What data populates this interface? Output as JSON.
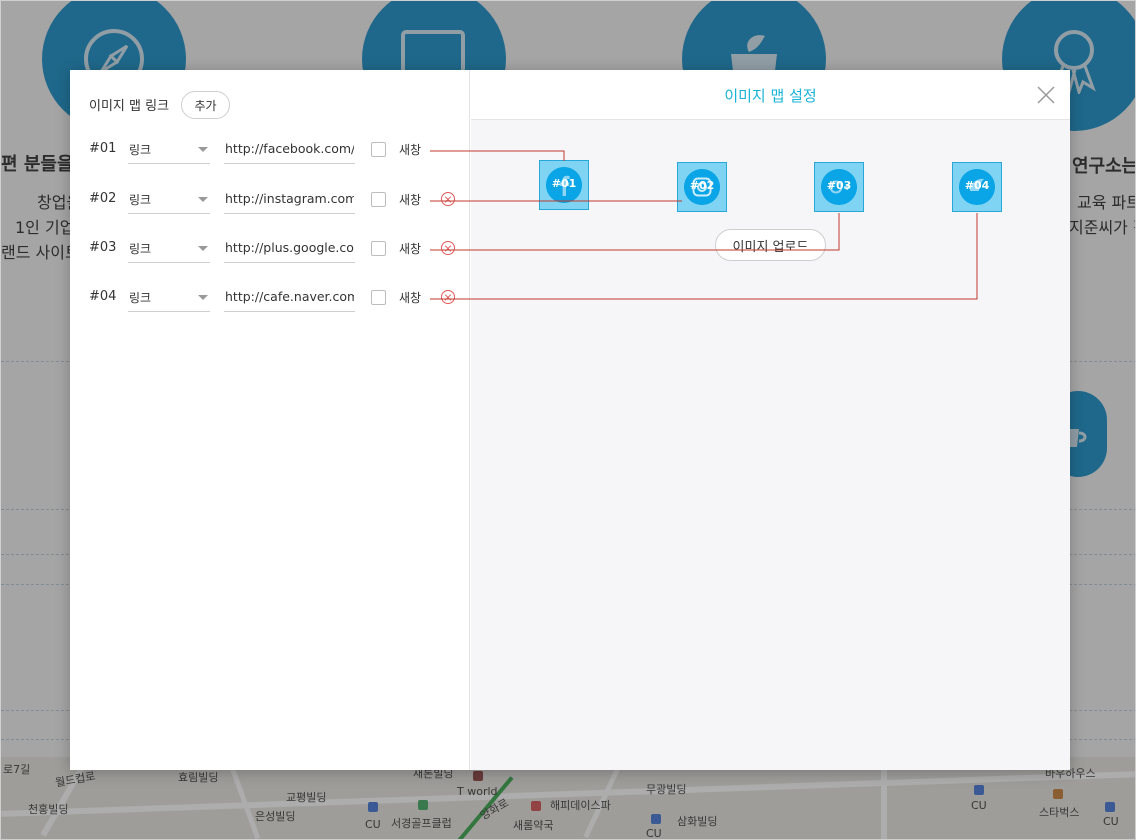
{
  "background": {
    "headings": [
      "편 분들을",
      "연구소는"
    ],
    "texts": [
      "창업을",
      "1인 기업",
      "랜드 사이트",
      "교육 파트",
      "지준씨가 직"
    ],
    "map_labels": [
      "로7길",
      "월드컵로",
      "천홍빌딩",
      "효림빌딩",
      "교평빌딩",
      "은성빌딩",
      "CU",
      "서경골프클럽",
      "새론빌딩",
      "T world",
      "양화로",
      "해피데이스파",
      "새롬약국",
      "무광빌딩",
      "삼화빌딩",
      "CU",
      "CU",
      "스타벅스",
      "CU",
      "바우하우스"
    ]
  },
  "modal": {
    "title": "이미지 맵 설정",
    "links_title": "이미지 맵 링크",
    "add_label": "추가",
    "upload_label": "이미지 업로드",
    "new_window_label": "새창",
    "rows": [
      {
        "num": "#01",
        "type": "링크",
        "url": "http://facebook.com/",
        "removable": false
      },
      {
        "num": "#02",
        "type": "링크",
        "url": "http://instagram.com/",
        "removable": true
      },
      {
        "num": "#03",
        "type": "링크",
        "url": "http://plus.google.com/",
        "removable": true
      },
      {
        "num": "#04",
        "type": "링크",
        "url": "http://cafe.naver.com/",
        "removable": true
      }
    ],
    "areas": [
      {
        "label": "#01",
        "icon": "facebook-icon"
      },
      {
        "label": "#02",
        "icon": "instagram-icon"
      },
      {
        "label": "#03",
        "icon": "google-plus-icon"
      },
      {
        "label": "#04",
        "icon": "naver-cafe-icon"
      }
    ]
  },
  "colors": {
    "accent": "#1ab3d8",
    "connector": "#c0392b",
    "area_fill": "#7fd3f3",
    "area_icon": "#0aa5e6",
    "bg_brand": "#0b88c4"
  }
}
